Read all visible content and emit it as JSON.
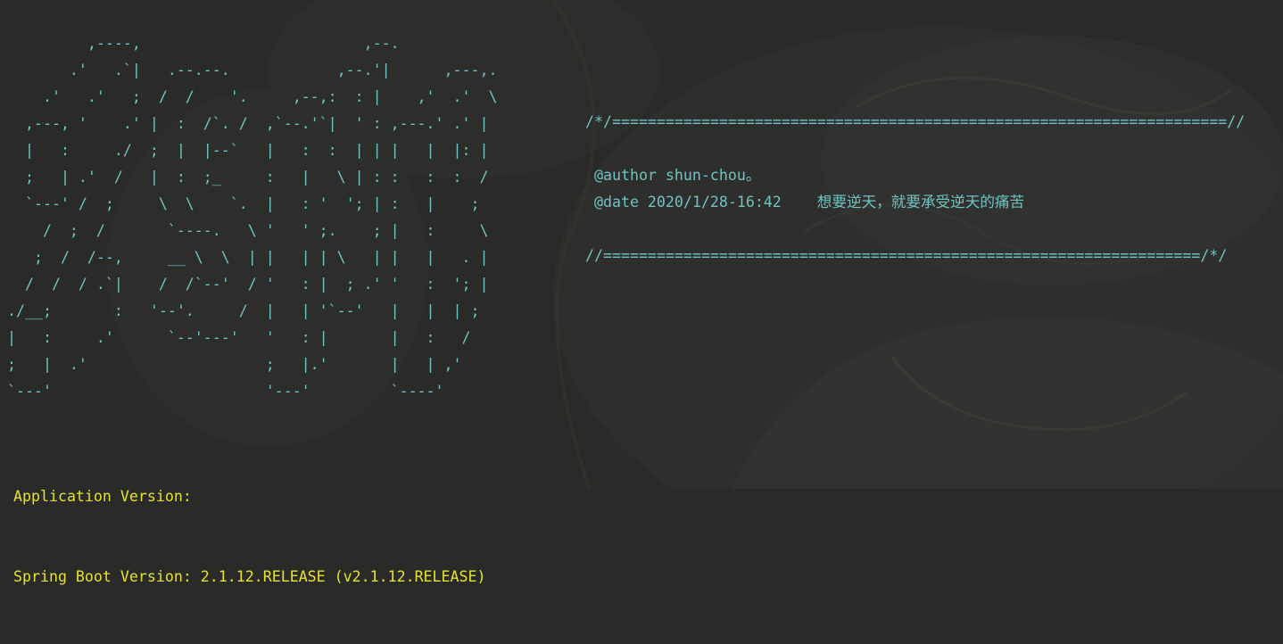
{
  "ascii_banner": [
    "         ,----,                         ,--.",
    "       .'   .`|   .--.--.            ,--.'|      ,---,.",
    "    .'   .'   ;  /  /    '.     ,--,:  : |    ,'  .'  \\",
    "  ,---, '    .' |  :  /`. /  ,`--.'`|  ' : ,---.' .' |",
    "  |   :     ./  ;  |  |--`   |   :  :  | | |   |  |: |",
    "  ;   | .'  /   |  :  ;_     :   |   \\ | : :   :  :  /",
    "  `---' /  ;     \\  \\    `.  |   : '  '; | :   |    ;",
    "    /  ;  /       `----.   \\ '   ' ;.    ; |   :     \\",
    "   ;  /  /--,     __ \\  \\  | |   | | \\   | |   |   . |",
    "  /  /  / .`|    /  /`--'  / '   : |  ; .' '   :  '; |",
    "./__;       :   '--'.     /  |   | '`--'   |   |  | ;",
    "|   :     .'      `--'---'   '   : |       |   :   /",
    ";   |  .'                    ;   |.'       |   | ,'",
    "`---'                        '---'         `----'"
  ],
  "header": {
    "top_rule": "/*/=====================================================================//",
    "author_line": " @author shun-chou。",
    "date_line": " @date 2020/1/28-16:42",
    "motto": "想要逆天，就要承受逆天的痛苦",
    "bottom_rule": "//===================================================================/*/"
  },
  "versions": {
    "application_version": "Application Version:",
    "spring_boot_version": "Spring Boot Version: 2.1.12.RELEASE (v2.1.12.RELEASE)"
  },
  "colors": {
    "background": "#2a2a28",
    "banner_text": "#6fc4c2",
    "version_text": "#e6e22e"
  }
}
